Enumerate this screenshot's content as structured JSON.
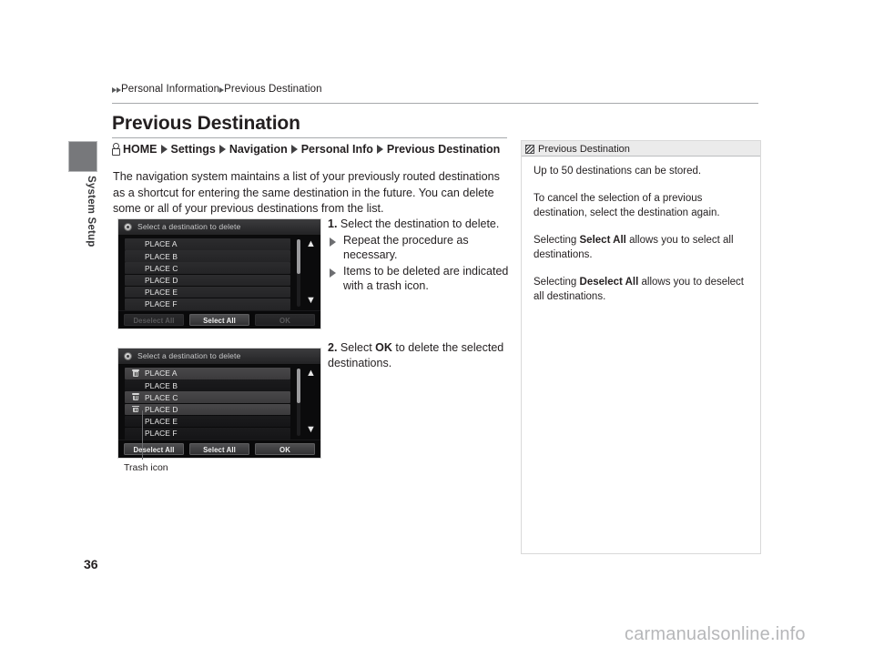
{
  "document": {
    "page_number": "36",
    "watermark": "carmanualsonline.info",
    "sidebar_label": "System Setup"
  },
  "breadcrumb": {
    "item1": "Personal Information",
    "item2": "Previous Destination"
  },
  "header": {
    "title": "Previous Destination"
  },
  "menu_path": {
    "home": "HOME",
    "step1": "Settings",
    "step2": "Navigation",
    "step3": "Personal Info",
    "step4": "Previous Destination"
  },
  "intro": {
    "text": "The navigation system maintains a list of your previously routed destinations as a shortcut for entering the same destination in the future. You can delete some or all of your previous destinations from the list."
  },
  "steps": [
    {
      "number": "1.",
      "text": "Select the destination to delete.",
      "substeps": [
        "Repeat the procedure as necessary.",
        "Items to be deleted are indicated with a trash icon."
      ]
    },
    {
      "number": "2.",
      "text_before": "Select",
      "text_bold": "OK",
      "text_after": "to delete the selected destinations.",
      "substeps": []
    }
  ],
  "screenshots": [
    {
      "id": "screenshot-select-destination",
      "header_title": "Select a destination to delete",
      "rows": [
        {
          "label": "PLACE A",
          "selected": false,
          "trash": false
        },
        {
          "label": "PLACE B",
          "selected": false,
          "trash": false
        },
        {
          "label": "PLACE C",
          "selected": false,
          "trash": false
        },
        {
          "label": "PLACE D",
          "selected": false,
          "trash": false
        },
        {
          "label": "PLACE E",
          "selected": false,
          "trash": false
        },
        {
          "label": "PLACE F",
          "selected": false,
          "trash": false
        }
      ],
      "buttons": [
        {
          "label": "Deselect All",
          "enabled": false
        },
        {
          "label": "Select All",
          "enabled": true
        },
        {
          "label": "OK",
          "enabled": false
        }
      ],
      "scroll_up_icon": "chevron-double-up-icon",
      "scroll_down_icon": "chevron-double-down-icon"
    },
    {
      "id": "screenshot-destinations-marked",
      "header_title": "Select a destination to delete",
      "rows": [
        {
          "label": "PLACE A",
          "selected": true,
          "trash": true
        },
        {
          "label": "PLACE B",
          "selected": false,
          "trash": false
        },
        {
          "label": "PLACE C",
          "selected": true,
          "trash": true
        },
        {
          "label": "PLACE D",
          "selected": true,
          "trash": true
        },
        {
          "label": "PLACE E",
          "selected": false,
          "trash": false
        },
        {
          "label": "PLACE F",
          "selected": false,
          "trash": false
        }
      ],
      "buttons": [
        {
          "label": "Deselect All",
          "enabled": true
        },
        {
          "label": "Select All",
          "enabled": true
        },
        {
          "label": "OK",
          "enabled": true
        }
      ],
      "scroll_up_icon": "chevron-double-up-icon",
      "scroll_down_icon": "chevron-double-down-icon"
    }
  ],
  "callout": {
    "label": "Trash icon"
  },
  "note": {
    "title": "Previous Destination",
    "paragraph1": "Up to 50 destinations can be stored.",
    "paragraph2": "To cancel the selection of a previous destination, select the destination again.",
    "paragraph3_before": "Selecting",
    "paragraph3_bold": "Select All",
    "paragraph3_after": "allows you to select all destinations.",
    "paragraph4_before": "Selecting",
    "paragraph4_bold": "Deselect All",
    "paragraph4_after": "allows you to deselect all destinations."
  },
  "colors": {
    "text": "#231f20",
    "rule": "#a7a9ac",
    "sidebar_tab": "#77787b",
    "note_header_bg": "#ebebeb",
    "watermark": "#b6b7b9"
  }
}
